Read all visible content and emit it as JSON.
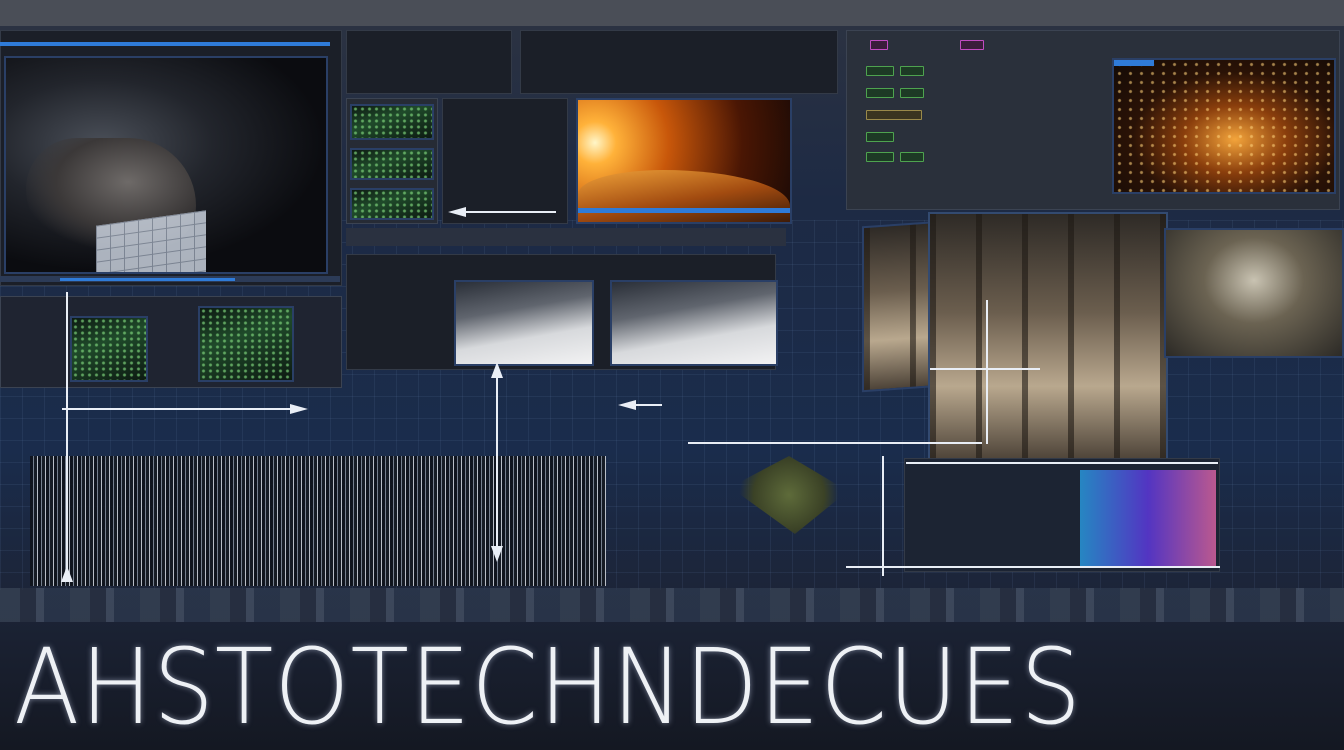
{
  "title": {
    "text": "AHSTOTECHNDECUES"
  },
  "colors": {
    "accent": "#2f7bd8",
    "green_button": "#4ea34f",
    "magenta_button": "#c14bc1",
    "background": "#1a2336"
  },
  "icons": {
    "arrow": "arrow-icon",
    "button": "timeline-button"
  }
}
